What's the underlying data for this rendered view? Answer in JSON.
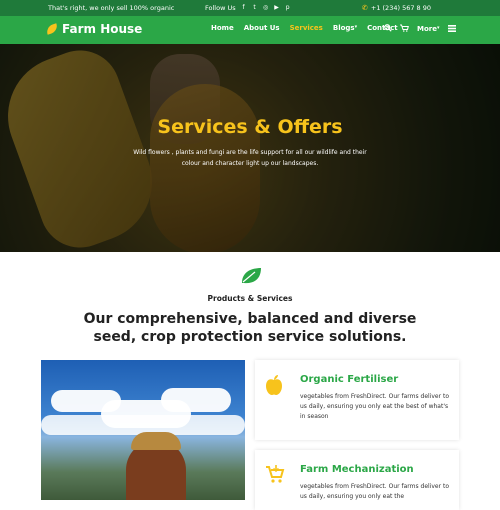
{
  "topbar": {
    "tagline": "That's right, we only sell 100% organic",
    "follow_label": "Follow Us",
    "social_icons": [
      "facebook-icon",
      "twitter-icon",
      "instagram-icon",
      "youtube-icon",
      "pinterest-icon"
    ],
    "phone": "+1 (234) 567 8 90"
  },
  "brand": {
    "name": "Farm House"
  },
  "nav": {
    "items": [
      {
        "label": "Home"
      },
      {
        "label": "About Us"
      },
      {
        "label": "Services",
        "active": true
      },
      {
        "label": "Blogs",
        "dropdown": true
      },
      {
        "label": "Contact"
      }
    ],
    "more_label": "More"
  },
  "hero": {
    "title": "Services & Offers",
    "subtitle": "Wild flowers , plants and fungi are the life support for all our wildlife and their colour and character light up our landscapes."
  },
  "section": {
    "tag": "Products & Services",
    "title": "Our comprehensive, balanced and diverse seed, crop protection service solutions."
  },
  "cards": [
    {
      "icon": "apple-icon",
      "title": "Organic Fertiliser",
      "text": "vegetables from FreshDirect. Our farms deliver to us daily, ensuring you only eat the best of what's in season"
    },
    {
      "icon": "cart-icon",
      "title": "Farm Mechanization",
      "text": "vegetables from FreshDirect. Our farms deliver to us daily, ensuring you only eat the"
    }
  ],
  "colors": {
    "green_dark": "#1f7a3a",
    "green": "#2ba747",
    "accent": "#f7c31c"
  }
}
